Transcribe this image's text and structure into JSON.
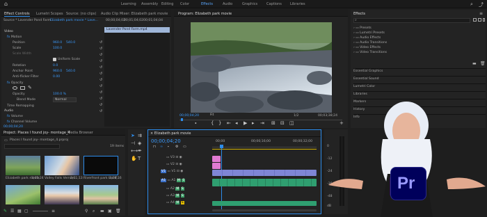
{
  "workspaces": {
    "learning": "Learning",
    "assembly": "Assembly",
    "editing": "Editing",
    "color": "Color",
    "effects": "Effects",
    "audio": "Audio",
    "graphics": "Graphics",
    "captions": "Captions",
    "libraries": "Libraries"
  },
  "source_tabs": {
    "effect_controls": "Effect Controls",
    "lumetri_scopes": "Lumetri Scopes",
    "source": "Source: (no clips)",
    "audio_mixer": "Audio Clip Mixer: Elizabeth park movie"
  },
  "effect_controls": {
    "source_label": "Source * Lavender Pond Farm...",
    "sequence_label": "Elizabeth park movie * Lave...",
    "timecode": "00;00;04;02",
    "ruler_a": "00;01;04;02",
    "ruler_b": "00;01;04;04",
    "clip_name": "Lavender Pond Farm.mp4",
    "video_header": "Video",
    "motion": "Motion",
    "position": "Position",
    "pos_x": "960.0",
    "pos_y": "540.0",
    "scale": "Scale",
    "scale_val": "100.0",
    "scale_width": "Scale Width",
    "uniform": "Uniform Scale",
    "rotation": "Rotation",
    "rotation_val": "0.0",
    "anchor": "Anchor Point",
    "anchor_x": "960.0",
    "anchor_y": "540.0",
    "flicker": "Anti-flicker Filter",
    "flicker_val": "0.00",
    "opacity_header": "Opacity",
    "opacity": "Opacity",
    "opacity_val": "100.0 %",
    "blend": "Blend Mode",
    "blend_val": "Normal",
    "time_remap": "Time Remapping",
    "audio_header": "Audio",
    "volume": "Volume",
    "channel_volume": "Channel Volume",
    "bottom_tc": "00;00;04;20"
  },
  "program": {
    "title": "Program: Elizabeth park movie",
    "timecode": "00;00;04;20",
    "fit": "Fit",
    "quality": "1/2",
    "duration": "00;03;38;24"
  },
  "effects_panel": {
    "title": "Effects",
    "items": [
      "Presets",
      "Lumetri Presets",
      "Audio Effects",
      "Audio Transitions",
      "Video Effects",
      "Video Transitions"
    ],
    "sections": [
      "Essential Graphics",
      "Essential Sound",
      "Lumetri Color",
      "Libraries",
      "Markers",
      "History",
      "Info"
    ]
  },
  "project": {
    "title": "Project: Places I found joy- montage_4",
    "media_browser": "Media Browser",
    "path": "Places I found joy- montage_4.prproj",
    "count": "19 items",
    "thumbs": [
      {
        "name": "Elizabeth park movie",
        "dur": "3;05;24"
      },
      {
        "name": "Valley Falls Vernon...",
        "dur": "2;01;13"
      },
      {
        "name": "Riverfront park Hartf...",
        "dur": "2;14;16"
      },
      {
        "name": "",
        "dur": ""
      },
      {
        "name": "",
        "dur": ""
      },
      {
        "name": "",
        "dur": ""
      }
    ]
  },
  "timeline": {
    "title": "Elizabeth park movie",
    "timecode": "00;00;04;20",
    "ruler": [
      "00;00",
      "00;00;16;00",
      "00;00;32;00"
    ],
    "video_tracks": [
      "V3",
      "V2",
      "V1"
    ],
    "audio_tracks": [
      "A1",
      "A2",
      "A3",
      "A4"
    ],
    "m_label": "M",
    "s_label": "S"
  },
  "meters": {
    "db": [
      "0",
      "-12",
      "-24",
      "-36",
      "-48",
      "dB"
    ]
  },
  "badge": {
    "label": "Pr"
  },
  "colors": {
    "accent": "#2d8ceb",
    "badge_bg": "#00005b",
    "badge_fg": "#9999ff",
    "clip_video": "#7f86d6",
    "clip_pink": "#e07ad1",
    "clip_audio": "#2f9f70"
  }
}
